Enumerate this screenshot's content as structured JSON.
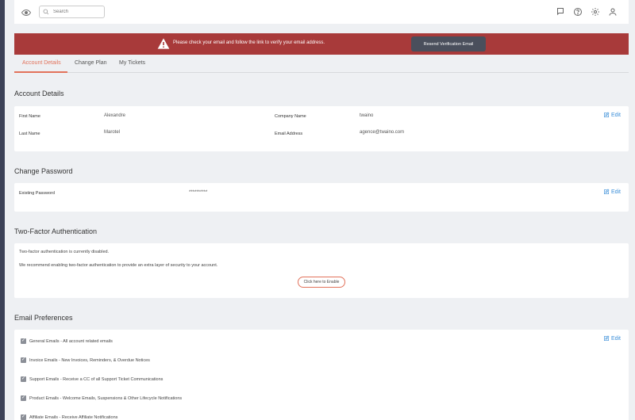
{
  "topbar": {
    "search_placeholder": "Search",
    "icons": [
      "eye-icon",
      "search-icon",
      "flag-icon",
      "help-icon",
      "gear-icon",
      "user-icon"
    ]
  },
  "alert": {
    "text": "Please check your email and follow the link to verify your email address.",
    "button_label": "Resend Verification Email",
    "color": "#a83a3a"
  },
  "tabs": [
    {
      "label": "Account Details",
      "active": true
    },
    {
      "label": "Change Plan",
      "active": false
    },
    {
      "label": "My Tickets",
      "active": false
    }
  ],
  "account_details": {
    "title": "Account Details",
    "first_name_label": "First Name",
    "first_name_value": "Alexandre",
    "last_name_label": "Last Name",
    "last_name_value": "Marotel",
    "company_label": "Company Name",
    "company_value": "twaino",
    "email_label": "Email Address",
    "email_value": "agence@twaino.com",
    "edit_label": "Edit"
  },
  "change_password": {
    "title": "Change Password",
    "existing_label": "Existing Password",
    "existing_value": "**********",
    "edit_label": "Edit"
  },
  "two_factor": {
    "title": "Two-Factor Authentication",
    "status_text": "Two-factor authentication is currently disabled.",
    "recommend_text": "We recommend enabling two-factor authentication to provide an extra layer of security to your account.",
    "enable_label": "Click here to Enable"
  },
  "email_prefs": {
    "title": "Email Preferences",
    "edit_label": "Edit",
    "items": [
      {
        "label": "General Emails - All account related emails",
        "checked": true
      },
      {
        "label": "Invoice Emails - New Invoices, Reminders, & Overdue Notices",
        "checked": true
      },
      {
        "label": "Support Emails - Receive a CC of all Support Ticket Communications",
        "checked": true
      },
      {
        "label": "Product Emails - Welcome Emails, Suspensions & Other Lifecycle Notifications",
        "checked": true
      },
      {
        "label": "Affiliate Emails - Receive Affiliate Notifications",
        "checked": true
      }
    ]
  },
  "colors": {
    "accent": "#e2725b",
    "link": "#3a8ed8"
  }
}
